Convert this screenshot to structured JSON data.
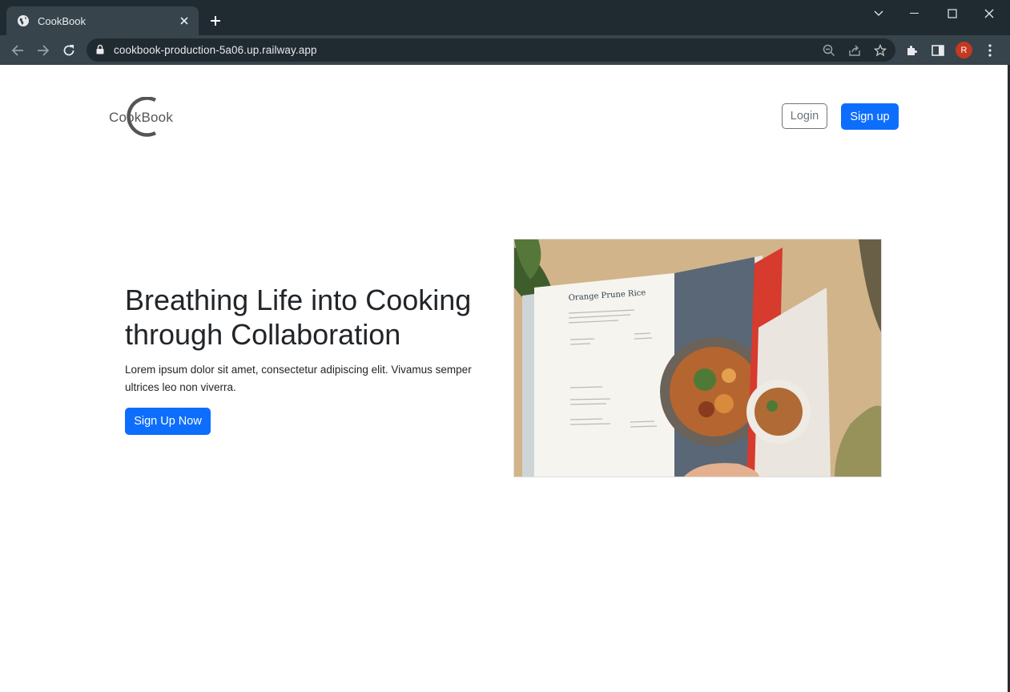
{
  "browser": {
    "tab_title": "CookBook",
    "url": "cookbook-production-5a06.up.railway.app",
    "profile_initial": "R"
  },
  "site": {
    "logo_text": "CookBook",
    "nav": {
      "login_label": "Login",
      "signup_label": "Sign up"
    }
  },
  "hero": {
    "title": "Breathing Life into Cooking through Collaboration",
    "text": "Lorem ipsum dolor sit amet, consectetur adipiscing elit. Vivamus semper ultrices leo non viverra.",
    "cta_label": "Sign Up Now",
    "image_recipe_title": "Orange Prune Rice"
  },
  "colors": {
    "primary": "#0d6efd",
    "secondary": "#6c757d",
    "text": "#212529",
    "chrome_dark": "#202a31",
    "chrome_toolbar": "#37444c"
  }
}
